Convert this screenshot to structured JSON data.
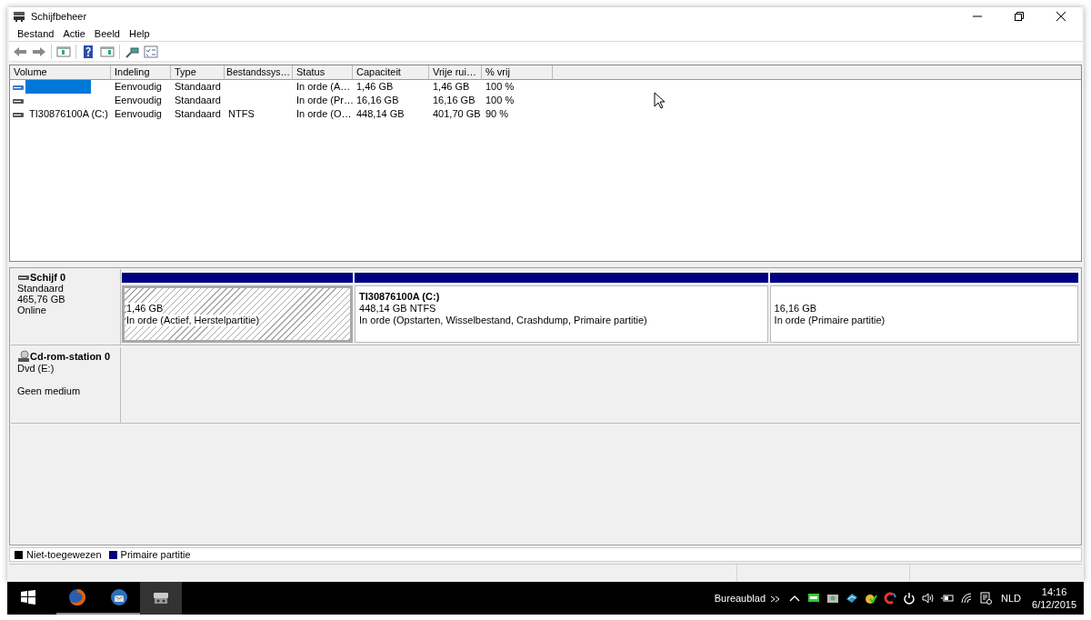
{
  "window": {
    "title": "Schijfbeheer"
  },
  "menu": [
    "Bestand",
    "Actie",
    "Beeld",
    "Help"
  ],
  "volume_list": {
    "columns": [
      "Volume",
      "Indeling",
      "Type",
      "Bestandssys…",
      "Status",
      "Capaciteit",
      "Vrije rui…",
      "% vrij"
    ],
    "rows": [
      {
        "layout": "Eenvoudig",
        "type": "Standaard",
        "status": "In orde (A…",
        "capacity": "1,46 GB",
        "free_space": "1,46 GB",
        "percent_free": "100 %",
        "selected": true
      },
      {
        "layout": "Eenvoudig",
        "type": "Standaard",
        "status": "In orde (Pr…",
        "capacity": "16,16 GB",
        "free_space": "16,16 GB",
        "percent_free": "100 %",
        "selected": false
      },
      {
        "volume": "TI30876100A (C:)",
        "layout": "Eenvoudig",
        "type": "Standaard",
        "file_system": "NTFS",
        "status": "In orde (O…",
        "capacity": "448,14 GB",
        "free_space": "401,70 GB",
        "percent_free": "90 %",
        "selected": false
      }
    ]
  },
  "disks": [
    {
      "kind": "disk",
      "name": "Schijf 0",
      "details": [
        "Standaard",
        "465,76 GB",
        "Online"
      ],
      "partitions": [
        {
          "size": "1,46 GB",
          "status": "In orde (Actief, Herstelpartitie)",
          "selected": true
        },
        {
          "label": "TI30876100A (C:)",
          "size": "448,14 GB NTFS",
          "status": "In orde (Opstarten, Wisselbestand, Crashdump, Primaire partitie)",
          "selected": false
        },
        {
          "size": "16,16 GB",
          "status": "In orde (Primaire partitie)",
          "selected": false
        }
      ]
    },
    {
      "kind": "cdrom",
      "name": "Cd-rom-station 0",
      "details": [
        "Dvd (E:)"
      ],
      "media": "Geen medium"
    }
  ],
  "legend": [
    {
      "label": "Niet-toegewezen",
      "color": "#000000"
    },
    {
      "label": "Primaire partitie",
      "color": "#000080"
    }
  ],
  "taskbar": {
    "apps": [
      {
        "kind": "browser",
        "selected": false
      },
      {
        "kind": "mail",
        "selected": false
      },
      {
        "kind": "disk",
        "selected": true
      }
    ],
    "toolbar_label": "Bureaublad",
    "language": "NLD",
    "time": "14:16",
    "date": "6/12/2015"
  }
}
